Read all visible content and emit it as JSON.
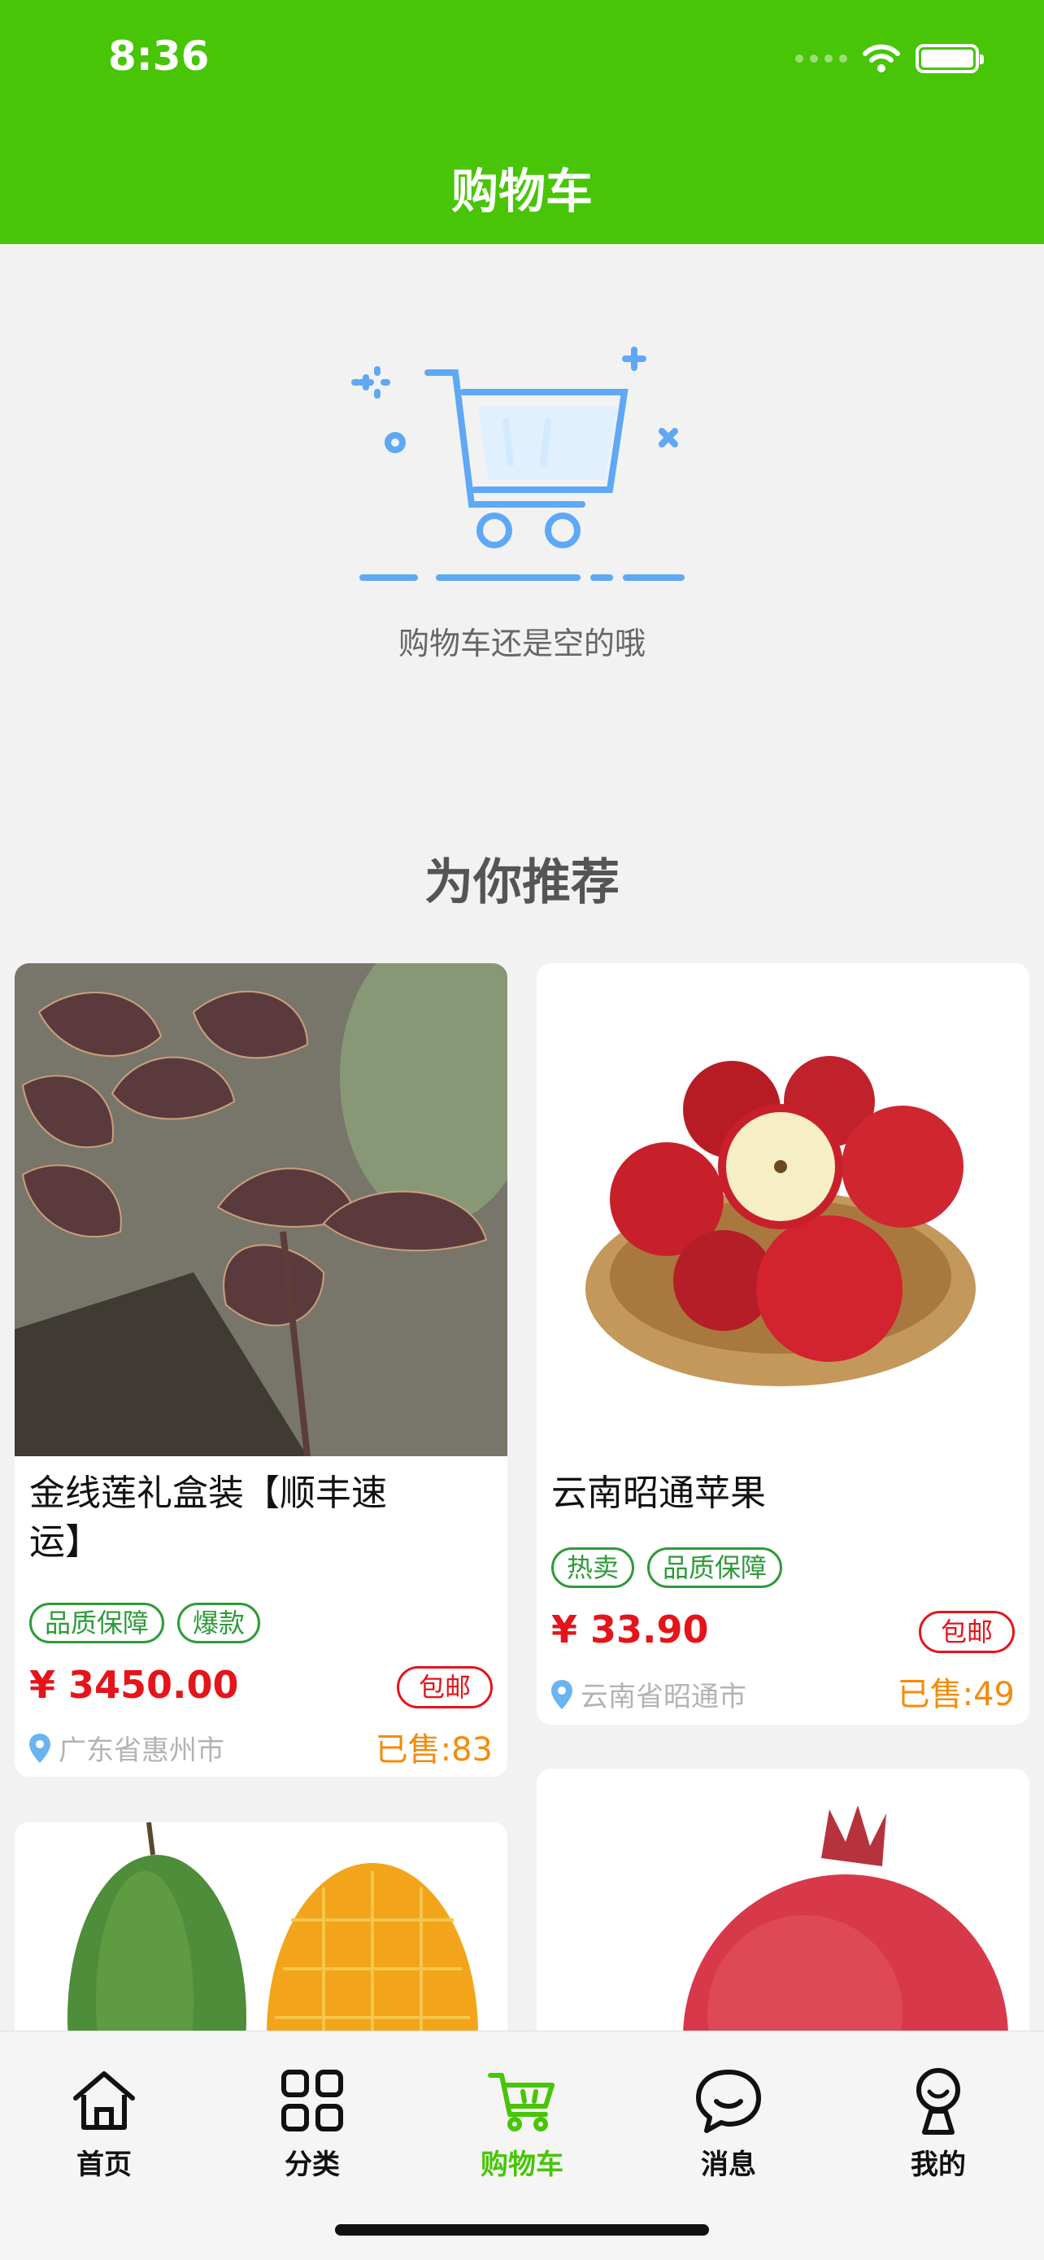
{
  "status_bar": {
    "time": "8:36"
  },
  "header": {
    "title": "购物车"
  },
  "empty_state": {
    "message": "购物车还是空的哦"
  },
  "recommend": {
    "title": "为你推荐"
  },
  "products": [
    {
      "name": "金线莲礼盒装【顺丰速运】",
      "tags": [
        "品质保障",
        "爆款"
      ],
      "price": "¥ 3450.00",
      "shipping": "包邮",
      "location": "广东省惠州市",
      "sold": "已售:83"
    },
    {
      "name": "云南昭通苹果",
      "tags": [
        "热卖",
        "品质保障"
      ],
      "price": "¥ 33.90",
      "shipping": "包邮",
      "location": "云南省昭通市",
      "sold": "已售:49"
    }
  ],
  "tabbar": {
    "items": [
      {
        "label": "首页",
        "icon": "home-icon"
      },
      {
        "label": "分类",
        "icon": "grid-icon"
      },
      {
        "label": "购物车",
        "icon": "cart-icon",
        "active": true
      },
      {
        "label": "消息",
        "icon": "chat-icon"
      },
      {
        "label": "我的",
        "icon": "profile-icon"
      }
    ]
  },
  "colors": {
    "brand": "#47c506",
    "price": "#e5141b",
    "tag": "#2f9a3a",
    "sold": "#f48b0b"
  }
}
